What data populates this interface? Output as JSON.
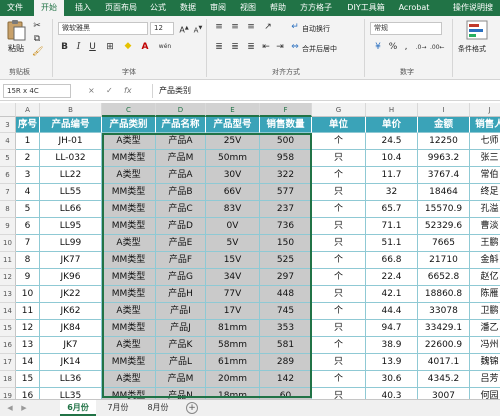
{
  "ribbon_tabs": [
    "文件",
    "开始",
    "插入",
    "页面布局",
    "公式",
    "数据",
    "审阅",
    "视图",
    "帮助",
    "方方格子",
    "DIY工具箱",
    "Acrobat",
    "操作说明搜"
  ],
  "active_tab": "开始",
  "ribbon": {
    "paste_label": "粘贴",
    "clipboard_label": "剪贴板",
    "font_name": "微软雅黑",
    "font_size": "12",
    "bold": "B",
    "italic": "I",
    "underline": "U",
    "font_label": "字体",
    "font_color_letter": "A",
    "phonetic_glyph": "wén",
    "wrap_text_label": "自动换行",
    "merge_center_label": "合并后居中",
    "alignment_label": "对齐方式",
    "number_format": "常规",
    "percent": "%",
    "comma": ",",
    "number_label": "数字",
    "conditional_format_label": "条件格式"
  },
  "formula_bar": {
    "name_box": "15R x 4C",
    "cancel_glyph": "×",
    "enter_glyph": "✓",
    "fx_label": "fx",
    "content": "产品类别"
  },
  "columns": [
    "A",
    "B",
    "C",
    "D",
    "E",
    "F",
    "G",
    "H",
    "I",
    "J"
  ],
  "row_numbers": [
    "3",
    "4",
    "5",
    "6",
    "7",
    "8",
    "9",
    "10",
    "11",
    "12",
    "13",
    "14",
    "15",
    "16",
    "17",
    "18",
    "19"
  ],
  "table_headers": [
    "序号",
    "产品编号",
    "产品类别",
    "产品名称",
    "产品型号",
    "销售数量",
    "单位",
    "单价",
    "金额",
    "销售人"
  ],
  "rows": [
    [
      "1",
      "JH-01",
      "A类型",
      "产品A",
      "25V",
      "500",
      "个",
      "24.5",
      "12250",
      "七师"
    ],
    [
      "2",
      "LL-032",
      "MM类型",
      "产品M",
      "50mm",
      "958",
      "只",
      "10.4",
      "9963.2",
      "张三"
    ],
    [
      "3",
      "LL22",
      "A类型",
      "产品A",
      "30V",
      "322",
      "个",
      "11.7",
      "3767.4",
      "常伯"
    ],
    [
      "4",
      "LL55",
      "MM类型",
      "产品B",
      "66V",
      "577",
      "只",
      "32",
      "18464",
      "终足"
    ],
    [
      "5",
      "LL66",
      "MM类型",
      "产品C",
      "83V",
      "237",
      "个",
      "65.7",
      "15570.9",
      "孔溢"
    ],
    [
      "6",
      "LL95",
      "MM类型",
      "产品D",
      "0V",
      "736",
      "只",
      "71.1",
      "52329.6",
      "曹淡"
    ],
    [
      "7",
      "LL99",
      "A类型",
      "产品E",
      "5V",
      "150",
      "只",
      "51.1",
      "7665",
      "王鹏"
    ],
    [
      "8",
      "JK77",
      "MM类型",
      "产品F",
      "15V",
      "525",
      "个",
      "66.8",
      "21710",
      "金斛"
    ],
    [
      "9",
      "JK96",
      "MM类型",
      "产品G",
      "34V",
      "297",
      "个",
      "22.4",
      "6652.8",
      "赵亿"
    ],
    [
      "10",
      "JK22",
      "MM类型",
      "产品H",
      "77V",
      "448",
      "只",
      "42.1",
      "18860.8",
      "陈雁"
    ],
    [
      "11",
      "JK62",
      "A类型",
      "产品I",
      "17V",
      "745",
      "个",
      "44.4",
      "33078",
      "卫鹏"
    ],
    [
      "12",
      "JK84",
      "MM类型",
      "产品J",
      "81mm",
      "353",
      "只",
      "94.7",
      "33429.1",
      "潘乙"
    ],
    [
      "13",
      "JK7",
      "A类型",
      "产品K",
      "58mm",
      "581",
      "个",
      "38.9",
      "22600.9",
      "冯州"
    ],
    [
      "14",
      "JK14",
      "MM类型",
      "产品L",
      "61mm",
      "289",
      "只",
      "13.9",
      "4017.1",
      "魏锦"
    ],
    [
      "15",
      "LL36",
      "A类型",
      "产品M",
      "20mm",
      "142",
      "个",
      "30.6",
      "4345.2",
      "吕芳"
    ],
    [
      "16",
      "LL35",
      "MM类型",
      "产品N",
      "18mm",
      "60",
      "只",
      "40.3",
      "3007",
      "何园"
    ]
  ],
  "sheet_tabs": [
    "6月份",
    "7月份",
    "8月份"
  ],
  "active_sheet": "6月份",
  "add_sheet_glyph": "+",
  "colors": {
    "ribbon_green": "#217346",
    "table_header": "#3aa3b8",
    "selection_fill": "#cacaca"
  }
}
